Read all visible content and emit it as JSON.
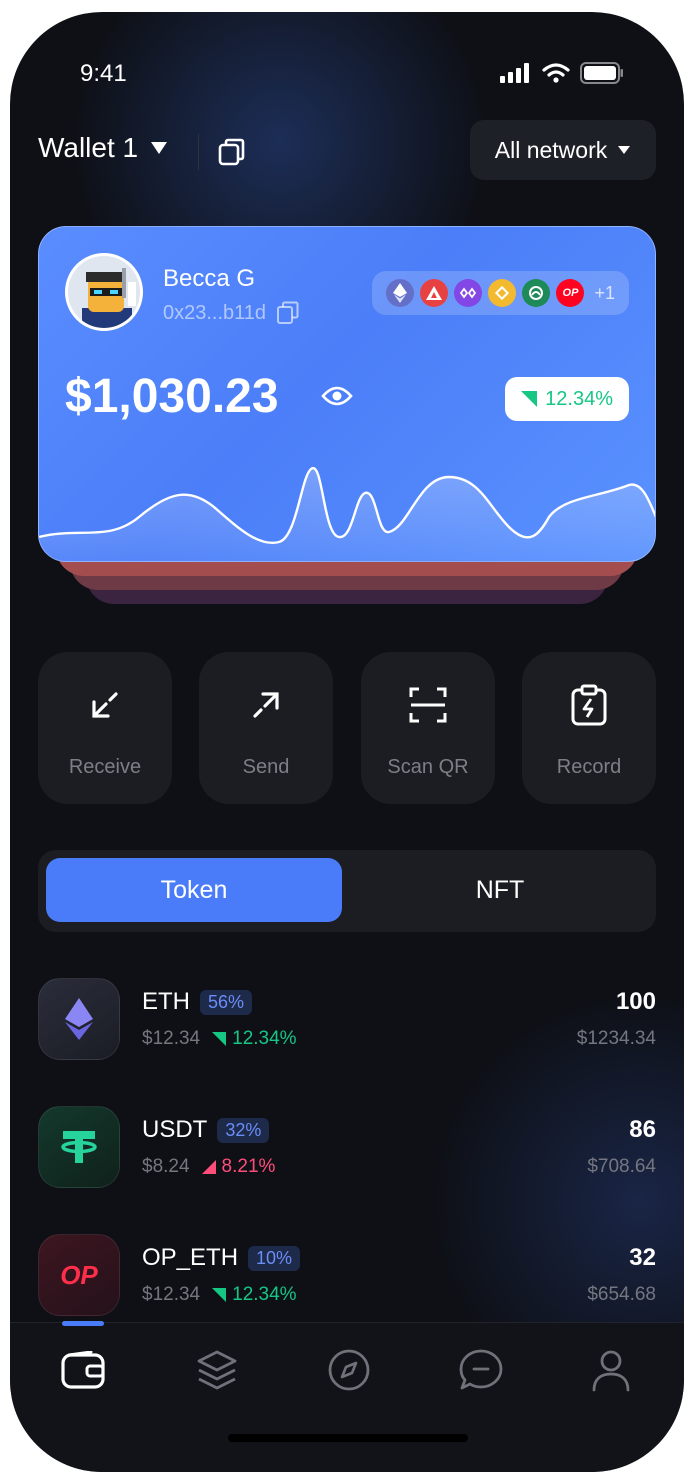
{
  "status_bar": {
    "time": "9:41"
  },
  "header": {
    "wallet_name": "Wallet 1",
    "network_label": "All network"
  },
  "card": {
    "user_name": "Becca G",
    "address": "0x23...b11d",
    "chains": [
      "ethereum",
      "avalanche",
      "polygon",
      "bnb",
      "gnosis",
      "optimism"
    ],
    "chains_more": "+1",
    "op_label": "OP",
    "balance": "$1,030.23",
    "change": "12.34%",
    "colors": {
      "accent": "#4a7cf9",
      "positive": "#16c784",
      "negative": "#ff4d7a"
    }
  },
  "actions": [
    {
      "label": "Receive",
      "icon": "arrow-down-left-icon"
    },
    {
      "label": "Send",
      "icon": "arrow-up-right-icon"
    },
    {
      "label": "Scan QR",
      "icon": "scan-icon"
    },
    {
      "label": "Record",
      "icon": "clipboard-icon"
    }
  ],
  "tabs": {
    "token": "Token",
    "nft": "NFT",
    "active": "Token"
  },
  "tokens": [
    {
      "symbol": "ETH",
      "share": "56%",
      "price": "$12.34",
      "change": "12.34%",
      "direction": "down",
      "amount": "100",
      "value": "$1234.34"
    },
    {
      "symbol": "USDT",
      "share": "32%",
      "price": "$8.24",
      "change": "8.21%",
      "direction": "up",
      "amount": "86",
      "value": "$708.64"
    },
    {
      "symbol": "OP_ETH",
      "share": "10%",
      "price": "$12.34",
      "change": "12.34%",
      "direction": "down",
      "amount": "32",
      "value": "$654.68",
      "icon_text": "OP"
    }
  ],
  "bottom_nav": [
    "wallet-icon",
    "layers-icon",
    "compass-icon",
    "chat-icon",
    "profile-icon"
  ]
}
